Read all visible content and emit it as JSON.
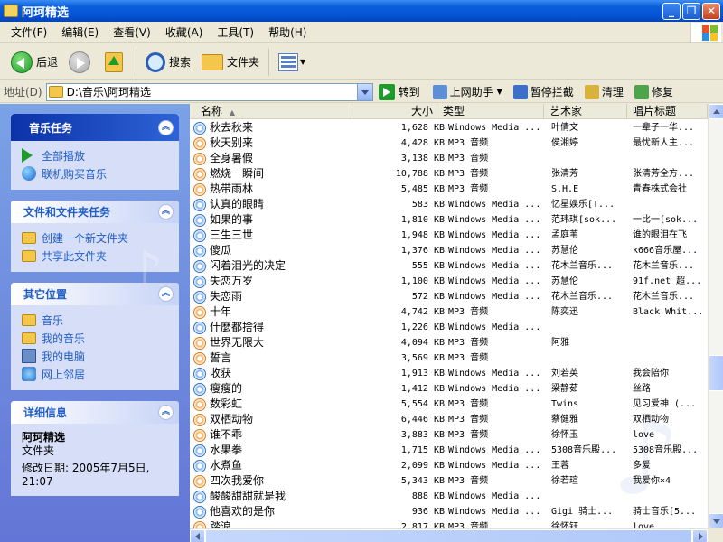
{
  "window": {
    "title": "阿珂精选",
    "buttons": {
      "minimize": "_",
      "maximize": "❐",
      "close": "✕"
    }
  },
  "menu": [
    {
      "label": "文件(F)"
    },
    {
      "label": "编辑(E)"
    },
    {
      "label": "查看(V)"
    },
    {
      "label": "收藏(A)"
    },
    {
      "label": "工具(T)"
    },
    {
      "label": "帮助(H)"
    }
  ],
  "toolbar": {
    "back_label": "后退",
    "search_label": "搜索",
    "folders_label": "文件夹"
  },
  "address": {
    "label": "地址(D)",
    "value": "D:\\音乐\\阿珂精选",
    "go_label": "转到",
    "tools": [
      "上网助手",
      "暂停拦截",
      "清理",
      "修复"
    ]
  },
  "taskpane": {
    "music_tasks": {
      "title": "音乐任务",
      "items": [
        "全部播放",
        "联机购买音乐"
      ]
    },
    "file_tasks": {
      "title": "文件和文件夹任务",
      "items": [
        "创建一个新文件夹",
        "共享此文件夹"
      ]
    },
    "other_places": {
      "title": "其它位置",
      "items": [
        "音乐",
        "我的音乐",
        "我的电脑",
        "网上邻居"
      ]
    },
    "details": {
      "title": "详细信息",
      "name": "阿珂精选",
      "kind": "文件夹",
      "modified_line1": "修改日期: 2005年7月5日,",
      "modified_line2": "21:07"
    }
  },
  "filelist": {
    "columns": [
      "名称",
      "大小",
      "类型",
      "艺术家",
      "唱片标题"
    ],
    "rows": [
      {
        "name": "秋去秋来",
        "size": "1,628 KB",
        "type": "Windows Media ...",
        "artist": "叶倩文",
        "album": "一辈子一华..."
      },
      {
        "name": "秋天别来",
        "size": "4,428 KB",
        "type": "MP3 音频",
        "artist": "侯湘婷",
        "album": "最忧新人主..."
      },
      {
        "name": "全身暑假",
        "size": "3,138 KB",
        "type": "MP3 音频",
        "artist": "",
        "album": ""
      },
      {
        "name": "燃烧一瞬间",
        "size": "10,788 KB",
        "type": "MP3 音频",
        "artist": "张清芳",
        "album": "张清芳全方..."
      },
      {
        "name": "热带雨林",
        "size": "5,485 KB",
        "type": "MP3 音频",
        "artist": "S.H.E",
        "album": "青春株式会社"
      },
      {
        "name": "认真的眼睛",
        "size": "583 KB",
        "type": "Windows Media ...",
        "artist": "忆星娱乐[T...",
        "album": ""
      },
      {
        "name": "如果的事",
        "size": "1,810 KB",
        "type": "Windows Media ...",
        "artist": "范玮琪[sok...",
        "album": "一比一[sok..."
      },
      {
        "name": "三生三世",
        "size": "1,948 KB",
        "type": "Windows Media ...",
        "artist": "孟庭苇",
        "album": "谁的眼泪在飞"
      },
      {
        "name": "傻瓜",
        "size": "1,376 KB",
        "type": "Windows Media ...",
        "artist": "苏慧伦",
        "album": "k666音乐屋..."
      },
      {
        "name": "闪着泪光的决定",
        "size": "555 KB",
        "type": "Windows Media ...",
        "artist": "花木兰音乐...",
        "album": "花木兰音乐..."
      },
      {
        "name": "失恋万岁",
        "size": "1,100 KB",
        "type": "Windows Media ...",
        "artist": "苏慧伦",
        "album": "91f.net 超..."
      },
      {
        "name": "失恋雨",
        "size": "572 KB",
        "type": "Windows Media ...",
        "artist": "花木兰音乐...",
        "album": "花木兰音乐..."
      },
      {
        "name": "十年",
        "size": "4,742 KB",
        "type": "MP3 音频",
        "artist": "陈奕迅",
        "album": "Black Whit..."
      },
      {
        "name": "什麼都捨得",
        "size": "1,226 KB",
        "type": "Windows Media ...",
        "artist": "",
        "album": ""
      },
      {
        "name": "世界无限大",
        "size": "4,094 KB",
        "type": "MP3 音频",
        "artist": "阿雅",
        "album": ""
      },
      {
        "name": "誓言",
        "size": "3,569 KB",
        "type": "MP3 音频",
        "artist": "",
        "album": ""
      },
      {
        "name": "收获",
        "size": "1,913 KB",
        "type": "Windows Media ...",
        "artist": "刘若英",
        "album": "我会陪你"
      },
      {
        "name": "瘦瘦的",
        "size": "1,412 KB",
        "type": "Windows Media ...",
        "artist": "梁静茹",
        "album": "丝路"
      },
      {
        "name": "数彩虹",
        "size": "5,554 KB",
        "type": "MP3 音频",
        "artist": "Twins",
        "album": "见习爱神 (..."
      },
      {
        "name": "双栖动物",
        "size": "6,446 KB",
        "type": "MP3 音频",
        "artist": "蔡健雅",
        "album": "双栖动物"
      },
      {
        "name": "谁不乖",
        "size": "3,883 KB",
        "type": "MP3 音频",
        "artist": "徐怀玉",
        "album": "love"
      },
      {
        "name": "水果拳",
        "size": "1,715 KB",
        "type": "Windows Media ...",
        "artist": "5308音乐殿...",
        "album": "5308音乐殿..."
      },
      {
        "name": "水煮鱼",
        "size": "2,099 KB",
        "type": "Windows Media ...",
        "artist": "王蓉",
        "album": "多爱"
      },
      {
        "name": "四次我爱你",
        "size": "5,343 KB",
        "type": "MP3 音频",
        "artist": "徐若瑄",
        "album": "我爱你×4"
      },
      {
        "name": "酸酸甜甜就是我",
        "size": "888 KB",
        "type": "Windows Media ...",
        "artist": "",
        "album": ""
      },
      {
        "name": "他喜欢的是你",
        "size": "936 KB",
        "type": "Windows Media ...",
        "artist": "Gigi 骑士...",
        "album": "骑士音乐[5..."
      },
      {
        "name": "踏浪",
        "size": "2,817 KB",
        "type": "MP3 音频",
        "artist": "徐怀钰",
        "album": "love"
      }
    ]
  },
  "colors": {
    "titlebar": "#0553d6",
    "taskpane_top": "#7ba2e7",
    "taskpane_bottom": "#6375d6",
    "link": "#215dc6"
  }
}
